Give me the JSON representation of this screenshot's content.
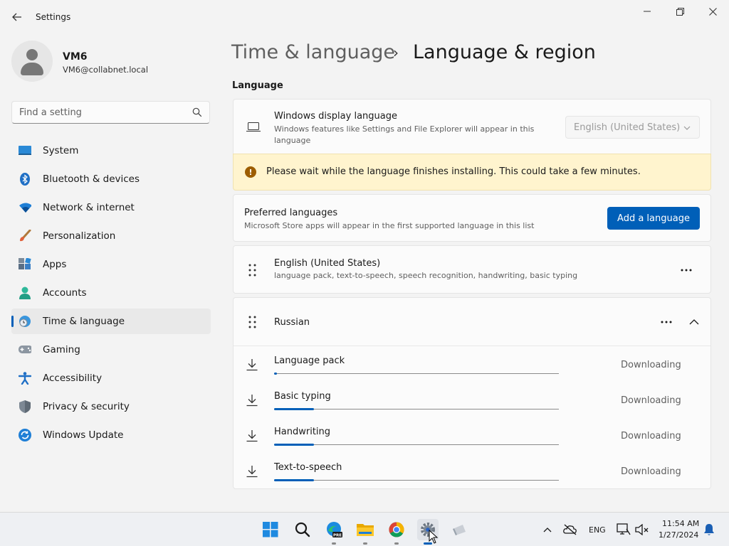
{
  "window": {
    "title": "Settings",
    "back_icon": "back-arrow-icon",
    "controls": [
      "minimize-icon",
      "restore-icon",
      "close-icon"
    ]
  },
  "profile": {
    "name": "VM6",
    "email": "VM6@collabnet.local"
  },
  "search": {
    "placeholder": "Find a setting",
    "value": ""
  },
  "nav": {
    "items": [
      {
        "label": "System",
        "icon": "system-icon"
      },
      {
        "label": "Bluetooth & devices",
        "icon": "bluetooth-icon"
      },
      {
        "label": "Network & internet",
        "icon": "wifi-icon"
      },
      {
        "label": "Personalization",
        "icon": "brush-icon"
      },
      {
        "label": "Apps",
        "icon": "apps-icon"
      },
      {
        "label": "Accounts",
        "icon": "accounts-icon"
      },
      {
        "label": "Time & language",
        "icon": "globe-clock-icon",
        "active": true
      },
      {
        "label": "Gaming",
        "icon": "gamepad-icon"
      },
      {
        "label": "Accessibility",
        "icon": "accessibility-icon"
      },
      {
        "label": "Privacy & security",
        "icon": "shield-icon"
      },
      {
        "label": "Windows Update",
        "icon": "update-icon"
      }
    ]
  },
  "breadcrumb": {
    "parent": "Time & language",
    "separator": "›",
    "current": "Language & region"
  },
  "language_section": {
    "title": "Language",
    "display_language": {
      "title": "Windows display language",
      "description": "Windows features like Settings and File Explorer will appear in this language",
      "selected": "English (United States)"
    },
    "warning": "Please wait while the language finishes installing. This could take a few minutes.",
    "preferred": {
      "title": "Preferred languages",
      "description": "Microsoft Store apps will appear in the first supported language in this list",
      "add_button": "Add a language"
    },
    "languages": [
      {
        "name": "English (United States)",
        "features": "language pack, text-to-speech, speech recognition, handwriting, basic typing"
      },
      {
        "name": "Russian",
        "expanded": true,
        "downloads": [
          {
            "label": "Language pack",
            "status": "Downloading",
            "progress": 0.01
          },
          {
            "label": "Basic typing",
            "status": "Downloading",
            "progress": 0.14
          },
          {
            "label": "Handwriting",
            "status": "Downloading",
            "progress": 0.14
          },
          {
            "label": "Text-to-speech",
            "status": "Downloading",
            "progress": 0.14
          }
        ]
      }
    ]
  },
  "taskbar": {
    "apps": [
      "windows-start-icon",
      "search-icon",
      "edge-beta-icon",
      "file-explorer-icon",
      "chrome-icon",
      "settings-icon",
      "misc-app-icon"
    ],
    "active_app": "settings-icon",
    "tray": {
      "language": "ENG",
      "time": "11:54 AM",
      "date": "1/27/2024"
    }
  },
  "colors": {
    "accent": "#005fb8",
    "warning_bg": "#fff4ce",
    "warning_icon": "#9d5d00"
  }
}
